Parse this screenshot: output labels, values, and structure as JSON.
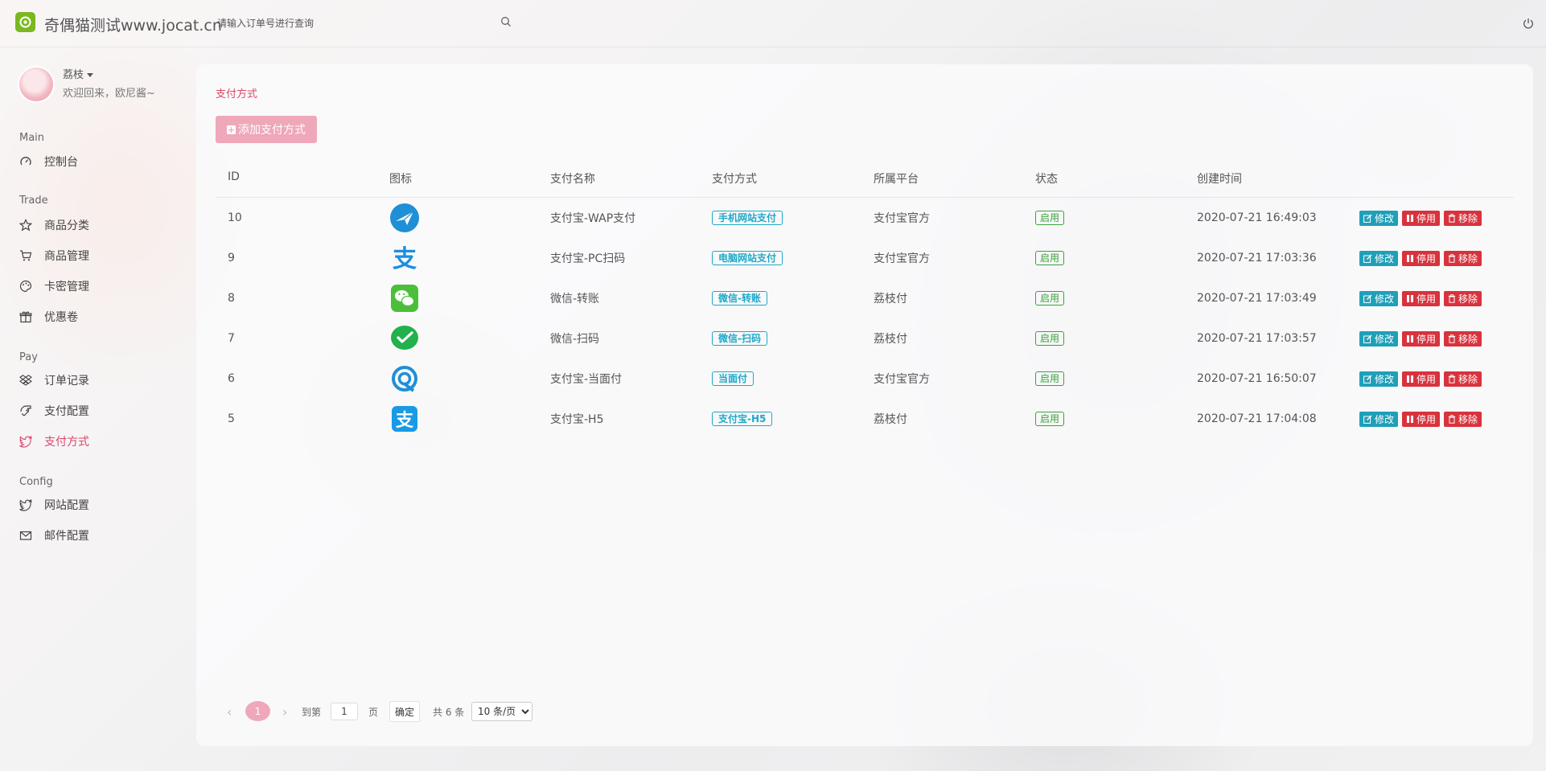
{
  "header": {
    "brand": "奇偶猫测试www.jocat.cn",
    "search_placeholder": "请输入订单号进行查询"
  },
  "user": {
    "name": "荔枝",
    "welcome": "欢迎回来，欧尼酱~"
  },
  "sidebar": {
    "groups": [
      "Main",
      "Trade",
      "Pay",
      "Config"
    ],
    "items": [
      {
        "label": "控制台",
        "icon": "dashboard-icon"
      },
      {
        "label": "商品分类",
        "icon": "star-icon"
      },
      {
        "label": "商品管理",
        "icon": "cart-icon"
      },
      {
        "label": "卡密管理",
        "icon": "palette-icon"
      },
      {
        "label": "优惠卷",
        "icon": "gift-icon"
      },
      {
        "label": "订单记录",
        "icon": "dropbox-icon"
      },
      {
        "label": "支付配置",
        "icon": "hand-icon"
      },
      {
        "label": "支付方式",
        "icon": "twitter-icon"
      },
      {
        "label": "网站配置",
        "icon": "twitter-icon"
      },
      {
        "label": "邮件配置",
        "icon": "mail-icon"
      }
    ],
    "active": "支付方式"
  },
  "main": {
    "breadcrumb": "支付方式",
    "add_button": "添加支付方式",
    "columns": [
      "ID",
      "图标",
      "支付名称",
      "支付方式",
      "所属平台",
      "状态",
      "创建时间"
    ],
    "rows": [
      {
        "id": "10",
        "icon": "alipay-wap-icon",
        "name": "支付宝-WAP支付",
        "method": "手机网站支付",
        "platform": "支付宝官方",
        "status": "启用",
        "created": "2020-07-21 16:49:03"
      },
      {
        "id": "9",
        "icon": "alipay-pc-icon",
        "name": "支付宝-PC扫码",
        "method": "电脑网站支付",
        "platform": "支付宝官方",
        "status": "启用",
        "created": "2020-07-21 17:03:36"
      },
      {
        "id": "8",
        "icon": "wechat-transfer-icon",
        "name": "微信-转账",
        "method": "微信-转账",
        "platform": "荔枝付",
        "status": "启用",
        "created": "2020-07-21 17:03:49"
      },
      {
        "id": "7",
        "icon": "wechat-scan-icon",
        "name": "微信-扫码",
        "method": "微信-扫码",
        "platform": "荔枝付",
        "status": "启用",
        "created": "2020-07-21 17:03:57"
      },
      {
        "id": "6",
        "icon": "alipay-face-icon",
        "name": "支付宝-当面付",
        "method": "当面付",
        "platform": "支付宝官方",
        "status": "启用",
        "created": "2020-07-21 16:50:07"
      },
      {
        "id": "5",
        "icon": "alipay-h5-icon",
        "name": "支付宝-H5",
        "method": "支付宝-H5",
        "platform": "荔枝付",
        "status": "启用",
        "created": "2020-07-21 17:04:08"
      }
    ],
    "row_actions": {
      "edit": "修改",
      "disable": "停用",
      "remove": "移除"
    }
  },
  "pagination": {
    "current_page": "1",
    "goto_label": "到第",
    "goto_value": "1",
    "page_unit": "页",
    "confirm": "确定",
    "total": "共 6 条",
    "page_size": "10 条/页"
  },
  "colors": {
    "accent": "#d9486a",
    "primary_button": "#efa7ba",
    "edit_button": "#1f9fb8",
    "danger_button": "#d8333d",
    "method_tag": "#1fa8c9",
    "status_tag": "#3aa33a"
  }
}
